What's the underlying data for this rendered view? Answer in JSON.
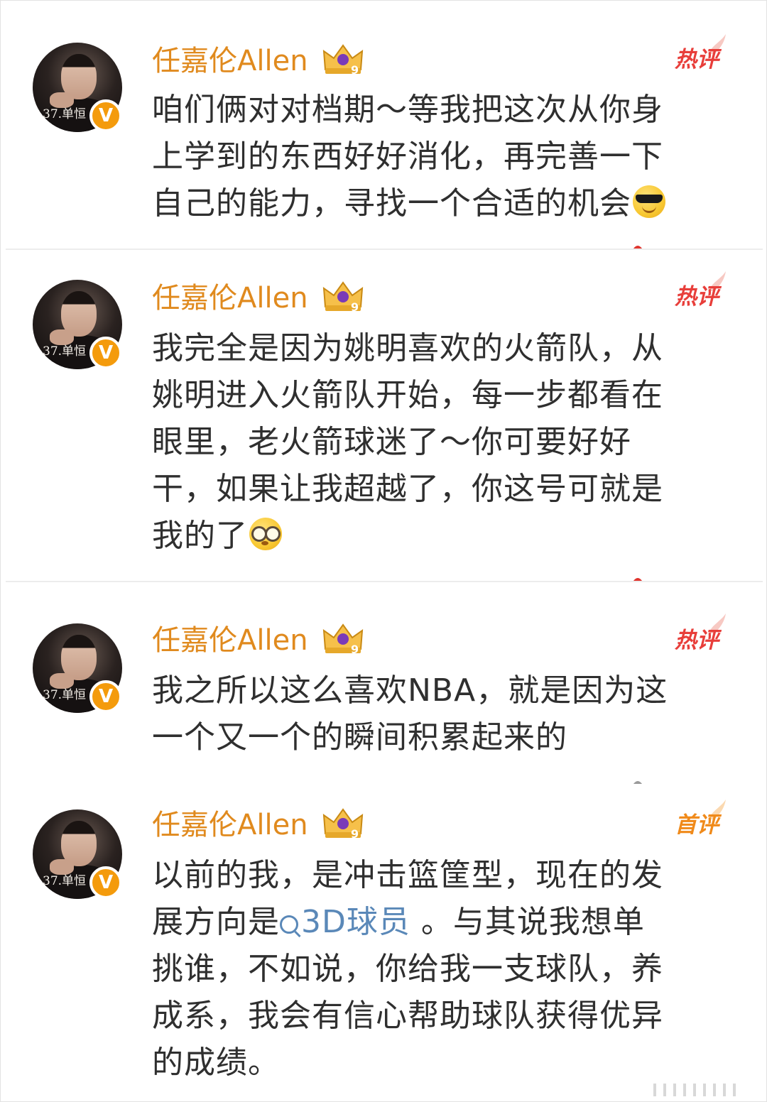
{
  "comments": [
    {
      "username": "任嘉伦Allen",
      "tag": "热评",
      "lines": [
        "咱们俩对对档期～等我把这次从你身",
        "上学到的东西好好消化，再完善一下",
        "自己的能力，寻找一个合适的机会"
      ],
      "trailing_emoji": "cool-sunglasses-emoji",
      "verified_badge": "V",
      "avatar_text": "37.单恒"
    },
    {
      "username": "任嘉伦Allen",
      "tag": "热评",
      "lines": [
        "我完全是因为姚明喜欢的火箭队，从",
        "姚明进入火箭队开始，每一步都看在",
        "眼里，老火箭球迷了～你可要好好",
        "干，如果让我超越了，你这号可就是",
        "我的了"
      ],
      "trailing_emoji": "glasses-emoji",
      "verified_badge": "V",
      "avatar_text": "37.单恒"
    },
    {
      "username": "任嘉伦Allen",
      "tag": "热评",
      "lines": [
        "我之所以这么喜欢NBA，就是因为这",
        "一个又一个的瞬间积累起来的"
      ],
      "verified_badge": "V",
      "avatar_text": "37.单恒"
    },
    {
      "username": "任嘉伦Allen",
      "tag": "首评",
      "line1": "以前的我，是冲击篮筐型，现在的发",
      "line2_prefix": "展方向是",
      "link_text": "3D球员",
      "line2_suffix": " 。与其说我想单",
      "lines_rest": [
        "挑谁，不如说，你给我一支球队，养",
        "成系，我会有信心帮助球队获得优异",
        "的成绩。"
      ],
      "verified_badge": "V",
      "avatar_text": "37.单恒"
    }
  ],
  "colors": {
    "username": "#e08a1e",
    "hot_tag": "#e83e3a",
    "first_tag": "#f08a1a",
    "link": "#5a88b8",
    "verified": "#f49b0c"
  }
}
